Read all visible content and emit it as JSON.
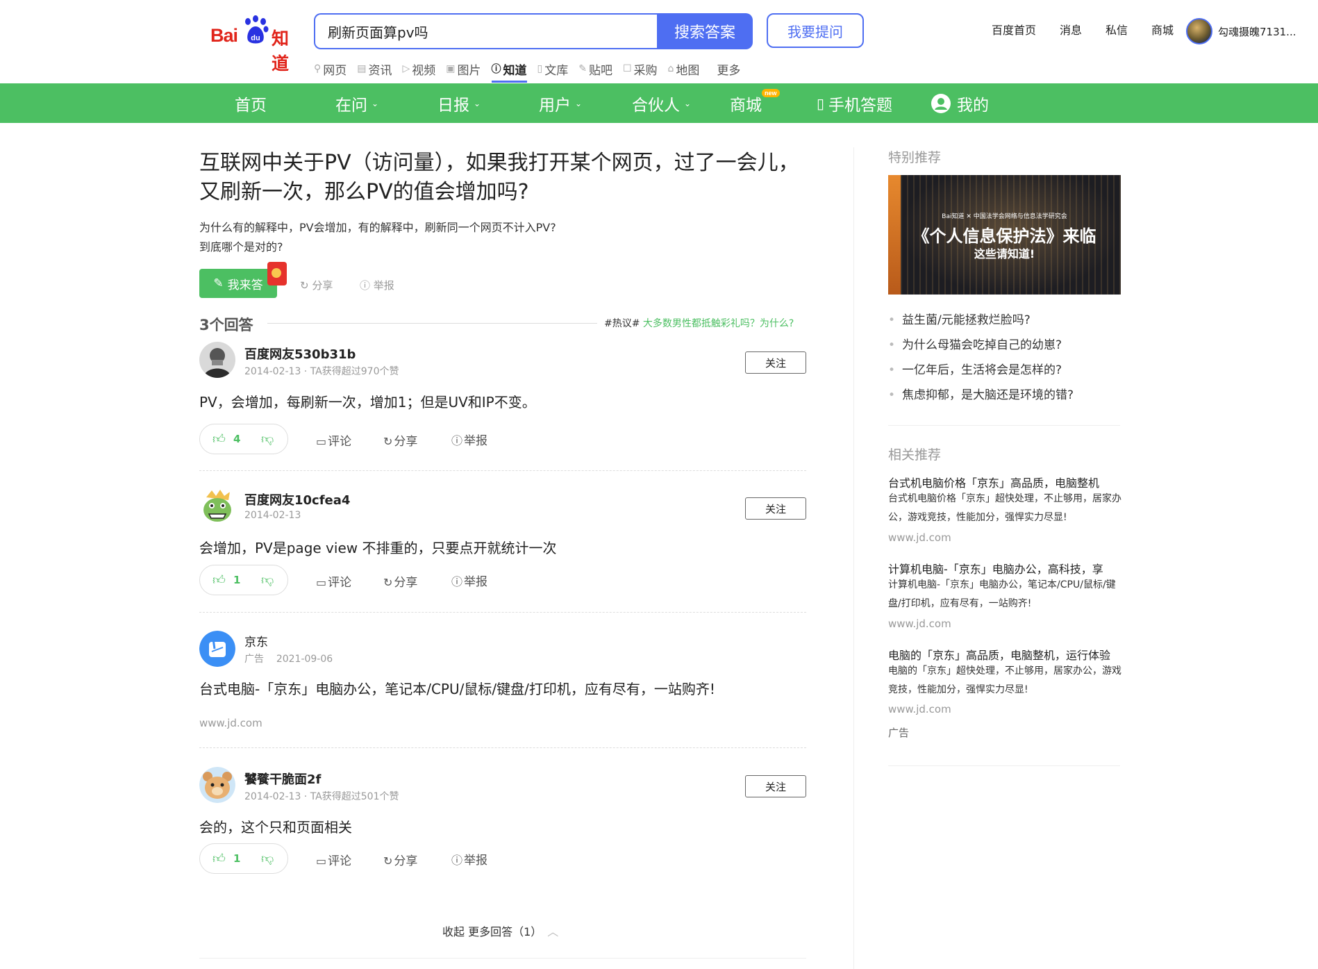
{
  "logo": {
    "bai": "Bai",
    "zhidao": "知道"
  },
  "search": {
    "value": "刷新页面算pv吗",
    "button": "搜索答案",
    "ask": "我要提问"
  },
  "top_links": [
    "百度首页",
    "消息",
    "私信",
    "商城"
  ],
  "user": {
    "name": "勾魂摄魄7131..."
  },
  "sub_nav": [
    {
      "label": "网页",
      "icon": "search-icon"
    },
    {
      "label": "资讯",
      "icon": "news-icon"
    },
    {
      "label": "视频",
      "icon": "video-icon"
    },
    {
      "label": "图片",
      "icon": "image-icon"
    },
    {
      "label": "知道",
      "icon": "question-icon",
      "active": true
    },
    {
      "label": "文库",
      "icon": "doc-icon"
    },
    {
      "label": "贴吧",
      "icon": "tieba-icon"
    },
    {
      "label": "采购",
      "icon": "purchase-icon"
    },
    {
      "label": "地图",
      "icon": "map-icon"
    },
    {
      "label": "更多"
    }
  ],
  "green_nav": {
    "items": [
      "首页",
      "在问",
      "日报",
      "用户",
      "合伙人",
      "商城",
      "手机答题",
      "我的"
    ],
    "new_badge": "new"
  },
  "question": {
    "title": "互联网中关于PV（访问量），如果我打开某个网页，过了一会儿，又刷新一次，那么PV的值会增加吗?",
    "desc_line1": "为什么有的解释中，PV会增加，有的解释中，刷新同一个网页不计入PV?",
    "desc_line2": "到底哪个是对的?",
    "answer_button": "我来答",
    "share": "分享",
    "report": "举报"
  },
  "answers_header": {
    "count": "3个回答",
    "hot_tag": "#热议#",
    "hot_link": "大多数男性都抵触彩礼吗？为什么?"
  },
  "answers": [
    {
      "name": "百度网友530b31b",
      "meta": "2014-02-13 · TA获得超过970个赞",
      "text": "PV，会增加，每刷新一次，增加1；但是UV和IP不变。",
      "votes": "4",
      "follow": "关注",
      "comment": "评论",
      "share": "分享",
      "report": "举报"
    },
    {
      "name": "百度网友10cfea4",
      "meta": "2014-02-13",
      "text": "会增加，PV是page view 不排重的，只要点开就统计一次",
      "votes": "1",
      "follow": "关注",
      "comment": "评论",
      "share": "分享",
      "report": "举报"
    },
    {
      "name": "饕餮干脆面2f",
      "meta": "2014-02-13 · TA获得超过501个赞",
      "text": "会的，这个只和页面相关",
      "votes": "1",
      "follow": "关注",
      "comment": "评论",
      "share": "分享",
      "report": "举报"
    }
  ],
  "ad_answer": {
    "name": "京东",
    "tag": "广告",
    "date": "2021-09-06",
    "text": "台式电脑-「京东」电脑办公，笔记本/CPU/鼠标/键盘/打印机，应有尽有，一站购齐!",
    "url": "www.jd.com"
  },
  "collapse": {
    "label": "收起 更多回答（1）"
  },
  "sidebar": {
    "special_title": "特别推荐",
    "banner": {
      "line1": "Bai知道 ✕ 中国法学会网络与信息法学研究会",
      "line2": "《个人信息保护法》来临",
      "line3": "这些请知道!"
    },
    "recommendations": [
      "益生菌/元能拯救烂脸吗?",
      "为什么母猫会吃掉自己的幼崽?",
      "一亿年后，生活将会是怎样的?",
      "焦虑抑郁，是大脑还是环境的错?"
    ],
    "related_title": "相关推荐",
    "related": [
      {
        "title": "台式机电脑价格「京东」高品质，电脑整机",
        "desc": "台式机电脑价格「京东」超快处理，不止够用，居家办公，游戏竞技，性能加分，强悍实力尽显!",
        "url": "www.jd.com"
      },
      {
        "title": "计算机电脑-「京东」电脑办公，高科技，享",
        "desc": "计算机电脑-「京东」电脑办公，笔记本/CPU/鼠标/键盘/打印机，应有尽有，一站购齐!",
        "url": "www.jd.com"
      },
      {
        "title": "电脑的「京东」高品质，电脑整机，运行体验",
        "desc": "电脑的「京东」超快处理，不止够用，居家办公，游戏竞技，性能加分，强悍实力尽显!",
        "url": "www.jd.com"
      }
    ],
    "ad_label": "广告"
  },
  "colors": {
    "brand_blue": "#4e6ef2",
    "green": "#4cbf62",
    "baidu_red": "#e1251b"
  }
}
